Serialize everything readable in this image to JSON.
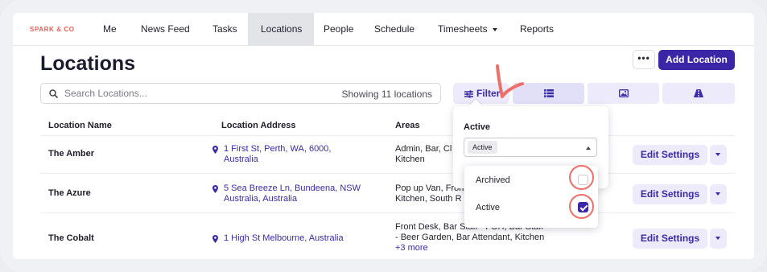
{
  "brand": "SPARK & CO",
  "nav": {
    "items": [
      {
        "label": "Me"
      },
      {
        "label": "News Feed"
      },
      {
        "label": "Tasks"
      },
      {
        "label": "Locations",
        "active": true
      },
      {
        "label": "People"
      },
      {
        "label": "Schedule"
      },
      {
        "label": "Timesheets",
        "has_dropdown": true
      },
      {
        "label": "Reports"
      }
    ]
  },
  "page": {
    "title": "Locations",
    "more_label": "•••",
    "add_label": "Add Location"
  },
  "toolbar": {
    "search_placeholder": "Search Locations...",
    "showing": "Showing 11 locations",
    "filter_label": "Filter",
    "views": [
      "list-view-icon",
      "image-view-icon",
      "map-view-icon"
    ]
  },
  "table": {
    "headers": [
      "Location Name",
      "Location Address",
      "Areas"
    ],
    "rows": [
      {
        "name": "The Amber",
        "address_1": "1 First St, Perth, WA, 6000,",
        "address_2": "Australia",
        "areas_1": "Admin, Bar, Cl",
        "areas_2": "Kitchen",
        "areas_more": "",
        "action": "Edit Settings"
      },
      {
        "name": "The Azure",
        "address_1": "5 Sea Breeze Ln, Bundeena, NSW",
        "address_2": "Australia, Australia",
        "areas_1": "Pop up Van, Fron",
        "areas_2": "Kitchen, South R",
        "areas_more": "",
        "action": "Edit Settings"
      },
      {
        "name": "The Cobalt",
        "address_1": "1 High St Melbourne, Australia",
        "address_2": "",
        "areas_1": "Front Desk, Bar Staff - FOH, Bar Staff",
        "areas_2": "- Beer Garden, Bar Attendant, Kitchen",
        "areas_more": "+3 more",
        "action": "Edit Settings"
      }
    ]
  },
  "filter_panel": {
    "label": "Active",
    "selected_chip": "Active",
    "options": [
      {
        "label": "Archived",
        "checked": false
      },
      {
        "label": "Active",
        "checked": true
      }
    ]
  },
  "colors": {
    "accent": "#3a26a7",
    "brand": "#e8615a",
    "annotation": "#ee6f6a"
  }
}
